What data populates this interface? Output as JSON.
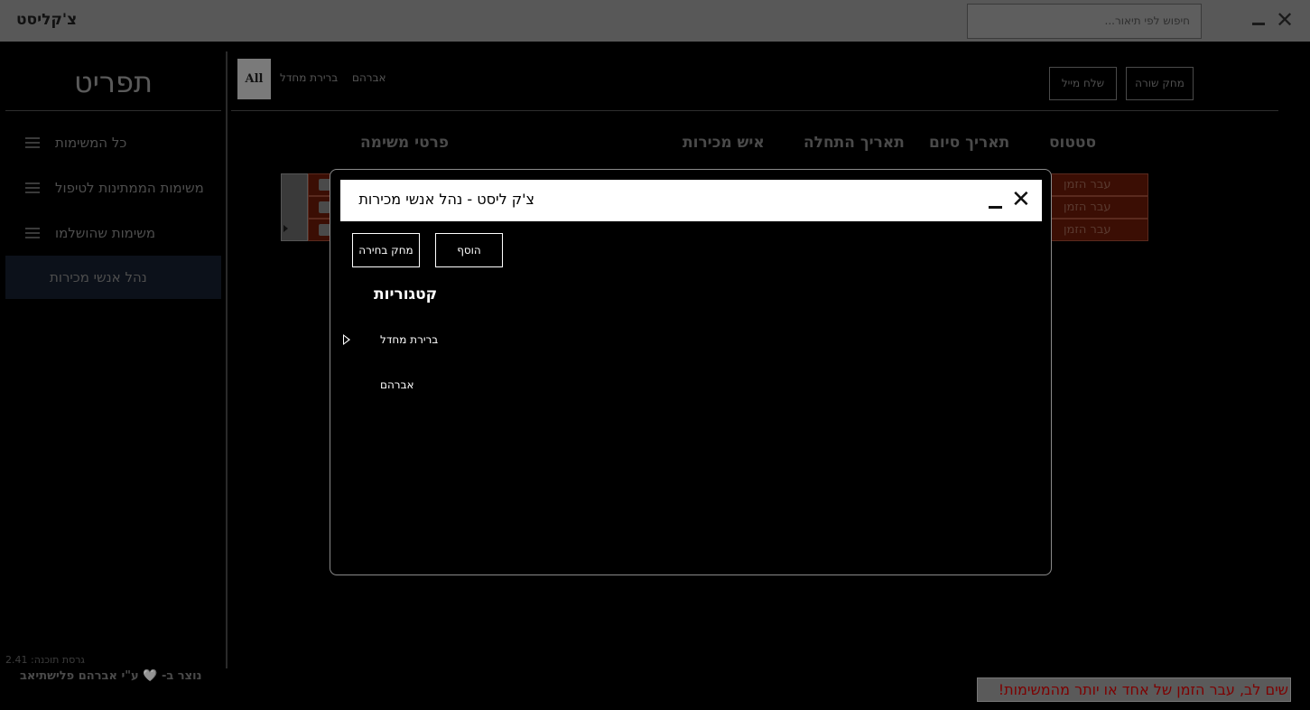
{
  "window": {
    "title": "צ'קליסט",
    "search_placeholder": "חיפוש לפי תיאור..."
  },
  "sidebar": {
    "title": "תפריט",
    "items": [
      {
        "label": "כל המשימות"
      },
      {
        "label": "משימות הממתינות לטיפול"
      },
      {
        "label": "משימות שהושלמו"
      },
      {
        "label": "נהל אנשי מכירות"
      }
    ],
    "version": "גרסת תוכנה: 2.41",
    "credit": "נוצר ב- 🩶 ע\"י אברהם פלישתיאב"
  },
  "filters": {
    "all": "All",
    "items": [
      "ברירת מחדל",
      "אברהם"
    ]
  },
  "toolbar": {
    "send_mail": "שלח מייל",
    "delete_row": "מחק שורה"
  },
  "table": {
    "headers": {
      "details": "פרטי משימה",
      "salesperson": "איש מכירות",
      "start": "תאריך התחלה",
      "end": "תאריך סיום",
      "status": "סטטוס"
    },
    "rows": [
      {
        "status": "עבר הזמן"
      },
      {
        "status": "עבר הזמן"
      },
      {
        "status": "עבר הזמן"
      }
    ]
  },
  "warning": "שים לב, עבר הזמן של אחד או יותר מהמשימות!",
  "modal": {
    "title": "צ'ק ליסט - נהל אנשי מכירות",
    "delete_selection": "מחק בחירה",
    "add": "הוסף",
    "categories_heading": "קטגוריות",
    "tree": [
      {
        "label": "ברירת מחדל",
        "expandable": true
      },
      {
        "label": "אברהם",
        "expandable": false
      }
    ]
  },
  "colors": {
    "overdue_row": "#3b0e04",
    "warning_text": "#7d0000",
    "overlay_titlebar": "#585858"
  }
}
